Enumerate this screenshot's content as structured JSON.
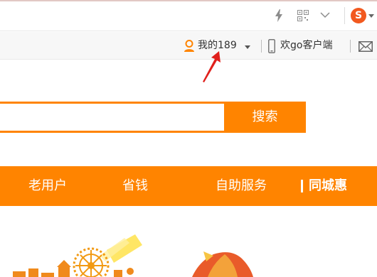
{
  "browser": {
    "icons": [
      "lightning-icon",
      "qr-code-icon",
      "chevron-down-icon",
      "sogou-logo"
    ],
    "sogou_letter": "S",
    "sogou_color": "#f2591f"
  },
  "topbar": {
    "my_account_label": "我的189",
    "client_label": "欢go客户端",
    "icons": [
      "user-icon",
      "phone-icon",
      "mail-icon"
    ]
  },
  "search": {
    "value": "",
    "button_label": "搜索"
  },
  "nav": {
    "items": [
      {
        "label": "老用户"
      },
      {
        "label": "省钱"
      },
      {
        "label": "自助服务"
      },
      {
        "label": "同城惠"
      }
    ]
  },
  "colors": {
    "accent": "#ff8400",
    "annotation_arrow": "#e0201c"
  }
}
